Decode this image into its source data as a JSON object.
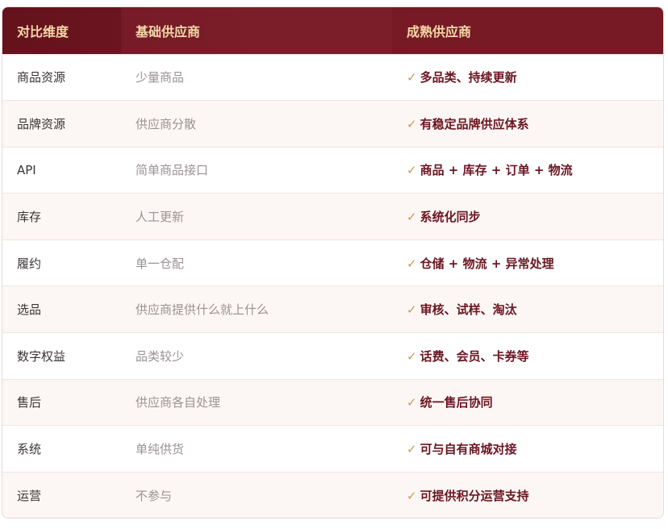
{
  "header": {
    "col1": "对比维度",
    "col2": "基础供应商",
    "col3": "成熟供应商"
  },
  "check_glyph": "✓",
  "rows": [
    {
      "dimension": "商品资源",
      "basic": "少量商品",
      "mature": "多品类、持续更新"
    },
    {
      "dimension": "品牌资源",
      "basic": "供应商分散",
      "mature": "有稳定品牌供应体系"
    },
    {
      "dimension": "API",
      "basic": "简单商品接口",
      "mature": "商品 + 库存 + 订单 + 物流"
    },
    {
      "dimension": "库存",
      "basic": "人工更新",
      "mature": "系统化同步"
    },
    {
      "dimension": "履约",
      "basic": "单一仓配",
      "mature": "仓储 + 物流 + 异常处理"
    },
    {
      "dimension": "选品",
      "basic": "供应商提供什么就上什么",
      "mature": "审核、试样、淘汰"
    },
    {
      "dimension": "数字权益",
      "basic": "品类较少",
      "mature": "话费、会员、卡券等"
    },
    {
      "dimension": "售后",
      "basic": "供应商各自处理",
      "mature": "统一售后协同"
    },
    {
      "dimension": "系统",
      "basic": "单纯供货",
      "mature": "可与自有商城对接"
    },
    {
      "dimension": "运营",
      "basic": "不参与",
      "mature": "可提供积分运营支持"
    }
  ],
  "colors": {
    "header_bg": "#7a1a26",
    "header_text": "#f3d9a7",
    "mature_text": "#6b1521",
    "check": "#c79b53",
    "basic_text": "#9b9294"
  }
}
